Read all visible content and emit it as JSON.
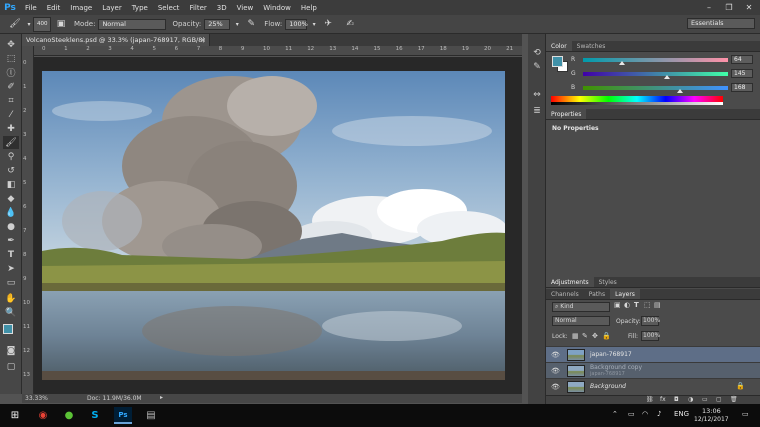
{
  "app": {
    "logo": "Ps",
    "menu": [
      "File",
      "Edit",
      "Image",
      "Layer",
      "Type",
      "Select",
      "Filter",
      "3D",
      "View",
      "Window",
      "Help"
    ],
    "window_controls": [
      "–",
      "❐",
      "✕"
    ]
  },
  "options_bar": {
    "brush_size": "400",
    "mode_label": "Mode:",
    "mode_value": "Normal",
    "opacity_label": "Opacity:",
    "opacity_value": "25%",
    "flow_label": "Flow:",
    "flow_value": "100%",
    "workspace": "Essentials"
  },
  "document": {
    "tab_title": "VolcanoSteeklens.psd @ 33.3% (japan-768917, RGB/8) *",
    "tab_close": "×",
    "ruler_top": [
      "0",
      "1",
      "2",
      "3",
      "4",
      "5",
      "6",
      "7",
      "8",
      "9",
      "10",
      "11",
      "12",
      "13",
      "14",
      "15",
      "16",
      "17",
      "18",
      "19",
      "20",
      "21"
    ],
    "ruler_left": [
      "0",
      "1",
      "2",
      "3",
      "4",
      "5",
      "6",
      "7",
      "8",
      "9",
      "10",
      "11",
      "12",
      "13"
    ]
  },
  "status": {
    "zoom": "33.33%",
    "doc_info": "Doc: 11.9M/36.0M"
  },
  "color_panel": {
    "tabs": [
      "Color",
      "Swatches"
    ],
    "active_tab": "Color",
    "r_label": "R",
    "g_label": "G",
    "b_label": "B",
    "r_value": "64",
    "g_value": "145",
    "b_value": "168",
    "r": 64,
    "g": 145,
    "b": 168,
    "foreground": "#4091a8",
    "background": "#ffffff"
  },
  "properties_panel": {
    "tab": "Properties",
    "content": "No Properties"
  },
  "adjust_tabs": [
    "Adjustments",
    "Styles"
  ],
  "layers_panel": {
    "tabs": [
      "Channels",
      "Paths",
      "Layers"
    ],
    "active_tab": "Layers",
    "kind_label": "Kind",
    "blend_mode": "Normal",
    "opacity_label": "Opacity:",
    "opacity_value": "100%",
    "lock_label": "Lock:",
    "fill_label": "Fill:",
    "fill_value": "100%",
    "layers": [
      {
        "name": "japan-768917",
        "selected": true,
        "sub": ""
      },
      {
        "name": "Background copy",
        "selected": false,
        "sub": "japan-768917"
      },
      {
        "name": "Background",
        "selected": false,
        "sub": ""
      }
    ]
  },
  "taskbar": {
    "language": "ENG",
    "time": "13:06",
    "date": "12/12/2017"
  }
}
